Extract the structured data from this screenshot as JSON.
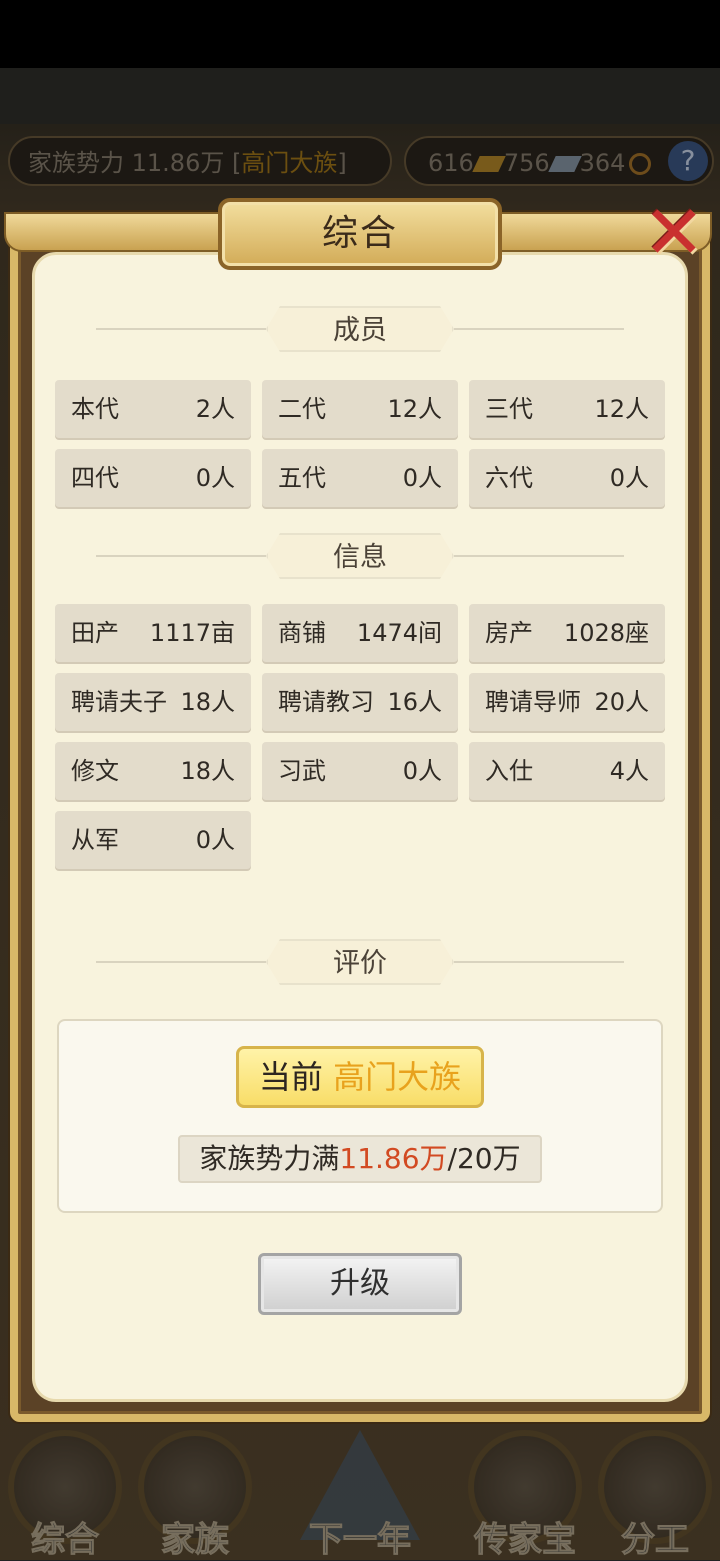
{
  "topbar": {
    "family_power_label": "家族势力",
    "family_power_value": "11.86万",
    "bracket_open": "[",
    "family_rank": "高门大族",
    "bracket_close": "]",
    "res_1": "616",
    "res_2": "756",
    "res_3": "364",
    "help_label": "?"
  },
  "dialog": {
    "title": "综合",
    "close_label": "✕",
    "sections": {
      "members": "成员",
      "info": "信息",
      "evaluation": "评价"
    },
    "members": [
      {
        "label": "本代",
        "value": "2人"
      },
      {
        "label": "二代",
        "value": "12人"
      },
      {
        "label": "三代",
        "value": "12人"
      },
      {
        "label": "四代",
        "value": "0人"
      },
      {
        "label": "五代",
        "value": "0人"
      },
      {
        "label": "六代",
        "value": "0人"
      }
    ],
    "info": [
      {
        "label": "田产",
        "value": "1117亩"
      },
      {
        "label": "商铺",
        "value": "1474间"
      },
      {
        "label": "房产",
        "value": "1028座"
      },
      {
        "label": "聘请夫子",
        "value": "18人"
      },
      {
        "label": "聘请教习",
        "value": "16人"
      },
      {
        "label": "聘请导师",
        "value": "20人"
      },
      {
        "label": "修文",
        "value": "18人"
      },
      {
        "label": "习武",
        "value": "0人"
      },
      {
        "label": "入仕",
        "value": "4人"
      },
      {
        "label": "从军",
        "value": "0人"
      }
    ],
    "evaluation": {
      "current_prefix": "当前",
      "current_rank": "高门大族",
      "power_prefix": "家族势力满",
      "power_current": "11.86万",
      "power_target": "/20万"
    },
    "upgrade_label": "升级"
  },
  "bottom_nav": [
    {
      "label": "综合"
    },
    {
      "label": "家族"
    },
    {
      "label": "下一年"
    },
    {
      "label": "传家宝"
    },
    {
      "label": "分工"
    }
  ],
  "colors": {
    "accent_rank": "#e8a21d",
    "power_current": "#d24a22",
    "close_icon": "#c9302f"
  }
}
